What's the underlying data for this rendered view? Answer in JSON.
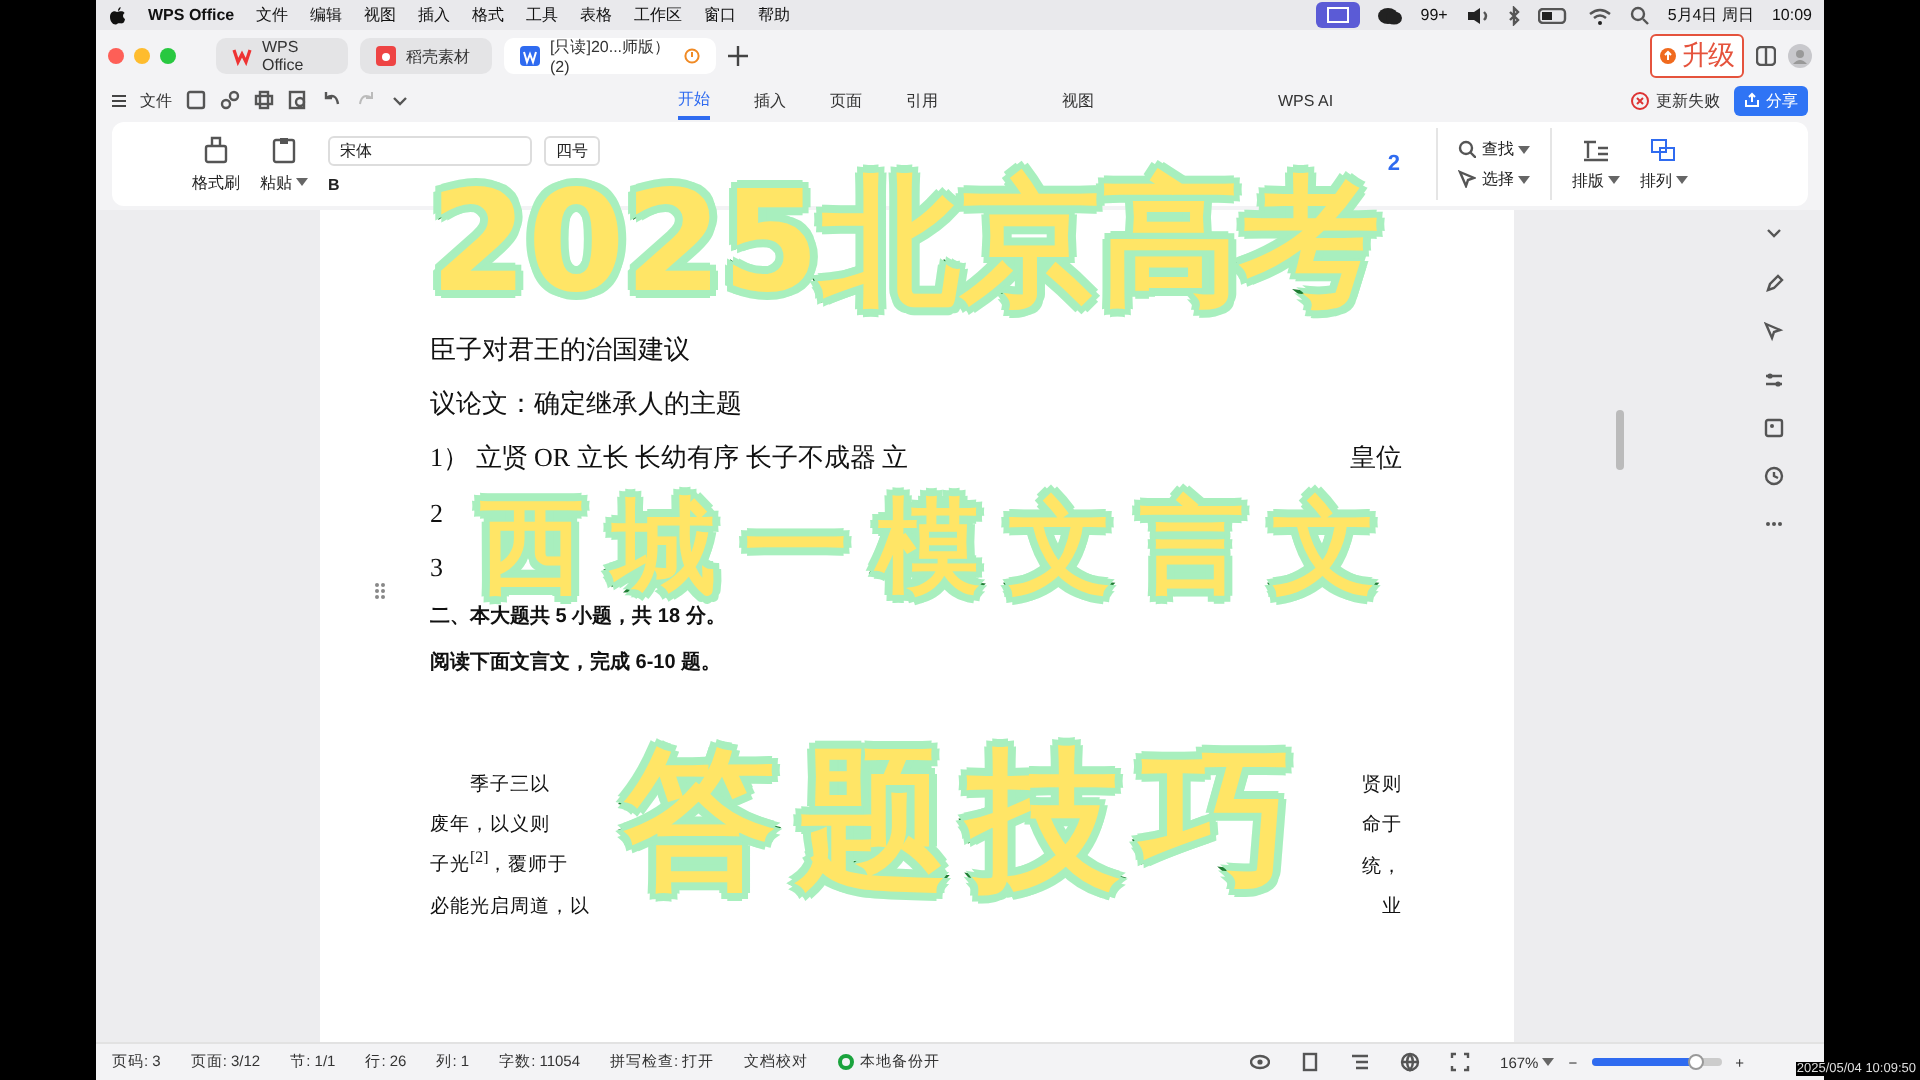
{
  "menu_bar": {
    "app": "WPS Office",
    "items": [
      "文件",
      "编辑",
      "视图",
      "插入",
      "格式",
      "工具",
      "表格",
      "工作区",
      "窗口",
      "帮助"
    ],
    "wechat_badge": "99+",
    "date": "5月4日 周日",
    "time": "10:09"
  },
  "doc_tabs": [
    {
      "label": "WPS Office",
      "selected": false,
      "kind": "home"
    },
    {
      "label": "稻壳素材",
      "selected": false,
      "kind": "store"
    },
    {
      "label": "[只读]20...师版）(2)",
      "selected": true,
      "kind": "doc"
    }
  ],
  "upgrade_button": "升级",
  "file_menu": "文件",
  "ribbon_tabs": [
    {
      "label": "开始",
      "selected": true
    },
    {
      "label": "插入",
      "selected": false
    },
    {
      "label": "页面",
      "selected": false
    },
    {
      "label": "引用",
      "selected": false
    },
    {
      "label": "视图",
      "selected": false
    },
    {
      "label": "WPS AI",
      "selected": false
    }
  ],
  "update_status": "更新失败",
  "share_button": "分享",
  "ribbon": {
    "format_painter": "格式刷",
    "paste": "粘贴",
    "font": "宋体",
    "size": "四号",
    "bold": "B",
    "style_fragment": "2",
    "find": "查找",
    "select": "选择",
    "layout": "排版",
    "arrange": "排列"
  },
  "document": {
    "lines": [
      {
        "kind": "normal",
        "parts": [
          "臣子对君王的治国建议"
        ]
      },
      {
        "kind": "normal",
        "parts": [
          "议论文：确定继承人的主题"
        ]
      },
      {
        "kind": "normal",
        "parts": [
          "1）  立贤  OR  立长  长幼有序  长子不成器  立",
          "皇位"
        ]
      },
      {
        "kind": "normal",
        "parts": [
          "2"
        ]
      },
      {
        "kind": "normal",
        "parts": [
          "3"
        ]
      },
      {
        "kind": "bold",
        "parts": [
          "二、本大题共 5 小题，共 18 分。"
        ]
      },
      {
        "kind": "bold",
        "parts": [
          "阅读下面文言文，完成 6-10 题。"
        ]
      },
      {
        "kind": "passage",
        "parts": [
          "季子三以",
          "贤则"
        ]
      },
      {
        "kind": "passage",
        "parts": [
          "废年，以义则",
          "命于"
        ]
      },
      {
        "kind": "passage",
        "parts": [
          "子光$^{[2]}$，覆师于",
          "统，"
        ]
      },
      {
        "kind": "passage",
        "parts": [
          "必能光启周道，以",
          "业"
        ]
      }
    ]
  },
  "status_bar": {
    "items": [
      "页码: 3",
      "页面: 3/12",
      "节: 1/1",
      "行: 26",
      "列: 1",
      "字数: 11054",
      "拼写检查: 打开",
      "文档校对"
    ],
    "backup": "本地备份开",
    "zoom_percent": "167%",
    "zoom_out": "−",
    "zoom_in": "+",
    "zoom_slider": {
      "level": 0.8
    }
  },
  "overlay_titles": [
    "2025北京高考",
    "西城一模文言文",
    "答题技巧"
  ],
  "timestamp": "2025/05/04 10:09:50"
}
